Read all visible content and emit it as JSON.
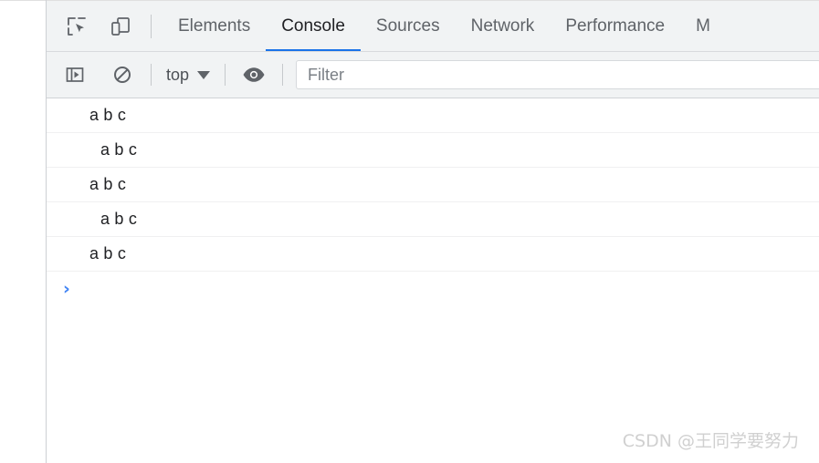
{
  "window": {
    "app": "Chrome DevTools"
  },
  "tabbar": {
    "icons": [
      {
        "name": "inspect-element-icon",
        "label": "Inspect element"
      },
      {
        "name": "device-toolbar-icon",
        "label": "Toggle device toolbar"
      }
    ],
    "tabs": [
      {
        "label": "Elements",
        "active": false
      },
      {
        "label": "Console",
        "active": true
      },
      {
        "label": "Sources",
        "active": false
      },
      {
        "label": "Network",
        "active": false
      },
      {
        "label": "Performance",
        "active": false
      },
      {
        "label": "M",
        "active": false
      }
    ],
    "active_tab": "Console",
    "active_underline_color": "#1a73e8",
    "background_color": "#f1f3f4"
  },
  "console_toolbar": {
    "sidebar_toggle_icon": "console-sidebar-icon",
    "clear_console_icon": "clear-console-icon",
    "context_selector": {
      "value": "top",
      "caret_icon": "chevron-down-icon"
    },
    "live_expression_icon": "eye-icon",
    "filter": {
      "value": "",
      "placeholder": "Filter"
    }
  },
  "console_output": {
    "messages": [
      {
        "text": "a b c",
        "indent": 0
      },
      {
        "text": "a b c",
        "indent": 12
      },
      {
        "text": "a b c",
        "indent": 0
      },
      {
        "text": "a b c",
        "indent": 12
      },
      {
        "text": "a b c",
        "indent": 0
      }
    ],
    "prompt": {
      "chevron": "›",
      "value": "",
      "color": "#4285f4"
    }
  },
  "watermark": {
    "text": "CSDN @王同学要努力",
    "color": "#d0d0d0"
  }
}
